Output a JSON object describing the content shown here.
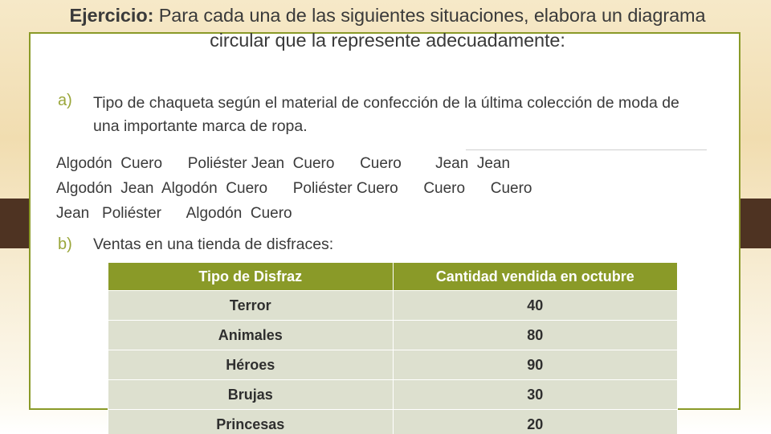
{
  "slide": {
    "title_bold": "Ejercicio:",
    "title_rest": " Para cada una de las siguientes situaciones, elabora un diagrama circular que la represente adecuadamente:",
    "items": [
      {
        "marker": "a)",
        "text": "Tipo de chaqueta según el material de confección de la última colección de moda de una importante marca de ropa."
      },
      {
        "marker": "b)",
        "text": "Ventas en una tienda de disfraces:"
      }
    ],
    "data_rows": [
      "Algodón  Cuero      Poliéster Jean  Cuero      Cuero        Jean  Jean",
      "Algodón  Jean  Algodón  Cuero      Poliéster Cuero      Cuero      Cuero",
      "Jean   Poliéster      Algodón  Cuero"
    ],
    "table": {
      "headers": [
        "Tipo de Disfraz",
        "Cantidad vendida en octubre"
      ],
      "rows": [
        [
          "Terror",
          "40"
        ],
        [
          "Animales",
          "80"
        ],
        [
          "Héroes",
          "90"
        ],
        [
          "Brujas",
          "30"
        ],
        [
          "Princesas",
          "20"
        ]
      ]
    },
    "colors": {
      "accent": "#8a9a28",
      "marker": "#9aa63a",
      "table_row_bg": "#dde0cf",
      "side_tab": "#4e3322"
    }
  }
}
